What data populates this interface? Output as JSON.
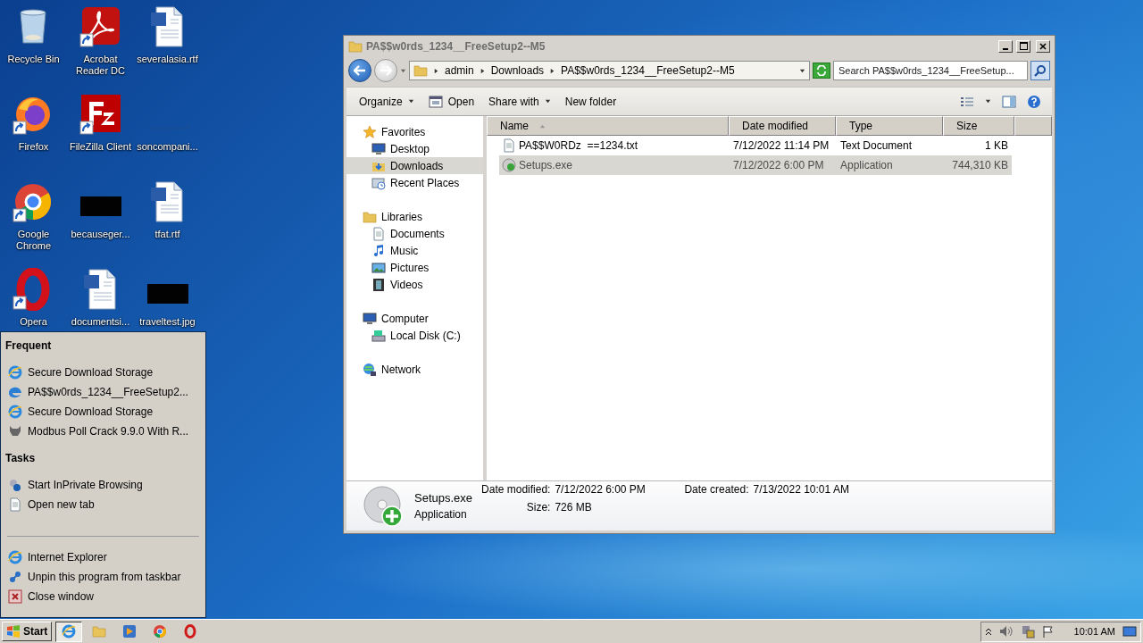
{
  "desktop_icons": [
    {
      "label": "Recycle Bin",
      "kind": "recycle",
      "shortcut": false
    },
    {
      "label": "Acrobat Reader DC",
      "kind": "acrobat",
      "shortcut": true
    },
    {
      "label": "severalasia.rtf",
      "kind": "word",
      "shortcut": false
    },
    {
      "label": "Firefox",
      "kind": "firefox",
      "shortcut": true
    },
    {
      "label": "FileZilla Client",
      "kind": "filezilla",
      "shortcut": true
    },
    {
      "label": "soncompani...",
      "kind": "blank",
      "shortcut": false
    },
    {
      "label": "Google Chrome",
      "kind": "chrome",
      "shortcut": true
    },
    {
      "label": "becauseger...",
      "kind": "dark",
      "shortcut": false
    },
    {
      "label": "tfat.rtf",
      "kind": "word",
      "shortcut": false
    },
    {
      "label": "Opera",
      "kind": "opera",
      "shortcut": true
    },
    {
      "label": "documentsi...",
      "kind": "word",
      "shortcut": false
    },
    {
      "label": "traveltest.jpg",
      "kind": "dark",
      "shortcut": false
    }
  ],
  "explorer": {
    "title": "PA$$w0rds_1234__FreeSetup2--M5",
    "breadcrumbs": [
      "admin",
      "Downloads",
      "PA$$w0rds_1234__FreeSetup2--M5"
    ],
    "search_placeholder": "Search PA$$w0rds_1234__FreeSetup...",
    "toolbar": [
      {
        "label": "Organize",
        "kind": "menu"
      },
      {
        "label": "Open",
        "kind": "open"
      },
      {
        "label": "Share with",
        "kind": "menu"
      },
      {
        "label": "New folder",
        "kind": "plain"
      }
    ],
    "nav": [
      {
        "label": "Favorites",
        "selected": false,
        "children": [
          {
            "label": "Desktop",
            "selected": false
          },
          {
            "label": "Downloads",
            "selected": true
          },
          {
            "label": "Recent Places",
            "selected": false
          }
        ]
      },
      {
        "label": "Libraries",
        "selected": false,
        "children": [
          {
            "label": "Documents",
            "selected": false
          },
          {
            "label": "Music",
            "selected": false
          },
          {
            "label": "Pictures",
            "selected": false
          },
          {
            "label": "Videos",
            "selected": false
          }
        ]
      },
      {
        "label": "Computer",
        "selected": false,
        "children": [
          {
            "label": "Local Disk (C:)",
            "selected": false
          }
        ]
      },
      {
        "label": "Network",
        "selected": false
      }
    ],
    "columns": [
      {
        "label": "Name",
        "sorted": true
      },
      {
        "label": "Date modified",
        "sorted": false
      },
      {
        "label": "Type",
        "sorted": false
      },
      {
        "label": "Size",
        "sorted": false
      }
    ],
    "files": [
      {
        "name": "PA$$W0RDz  ==1234.txt",
        "date": "7/12/2022 11:14 PM",
        "type": "Text Document",
        "size": "1 KB",
        "selected": false
      },
      {
        "name": "Setups.exe",
        "date": "7/12/2022 6:00 PM",
        "type": "Application",
        "size": "744,310 KB",
        "selected": true
      }
    ],
    "details": {
      "name": "Setups.exe",
      "type": "Application",
      "fields": [
        {
          "label": "Date modified:",
          "value": "7/12/2022 6:00 PM"
        },
        {
          "label": "Date created:",
          "value": "7/13/2022 10:01 AM"
        },
        {
          "label": "Size:",
          "value": "726 MB"
        }
      ]
    }
  },
  "jump_list": {
    "sections": [
      {
        "title": "Frequent",
        "items": [
          "Secure Download Storage",
          "PA$$w0rds_1234__FreeSetup2...",
          "Secure Download Storage",
          "Modbus Poll Crack 9.9.0 With R..."
        ]
      },
      {
        "title": "Tasks",
        "items": [
          "Start InPrivate Browsing",
          "Open new tab"
        ]
      }
    ],
    "pinned": [
      "Internet Explorer",
      "Unpin this program from taskbar",
      "Close window"
    ]
  },
  "taskbar": {
    "start": "Start",
    "apps": [
      {
        "kind": "ie",
        "selected": true
      },
      {
        "kind": "explorer",
        "selected": false
      },
      {
        "kind": "media",
        "selected": false
      },
      {
        "kind": "chrome",
        "selected": false
      },
      {
        "kind": "opera",
        "selected": false
      }
    ],
    "clock": "10:01 AM"
  }
}
